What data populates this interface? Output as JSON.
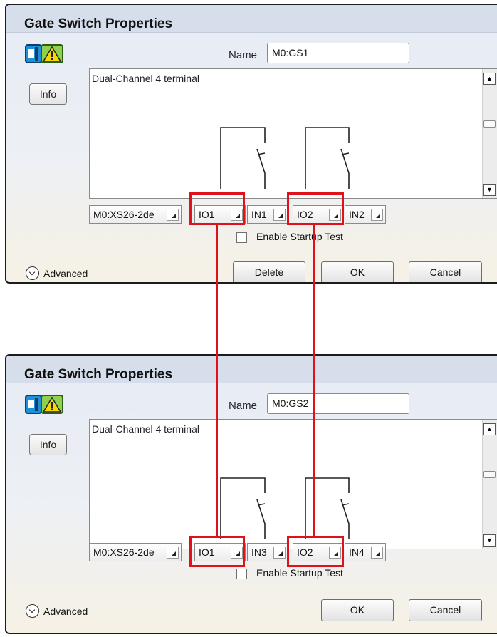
{
  "dialogs": [
    {
      "title": "Gate Switch Properties",
      "name_label": "Name",
      "name_value": "M0:GS1",
      "info_label": "Info",
      "description": "Dual-Channel 4 terminal",
      "module_combo": "M0:XS26-2de",
      "io_a": "IO1",
      "input_a": "IN1",
      "io_b": "IO2",
      "input_b": "IN2",
      "startup_test_label": "Enable Startup Test",
      "startup_test_checked": false,
      "advanced_label": "Advanced",
      "delete_label": "Delete",
      "ok_label": "OK",
      "cancel_label": "Cancel"
    },
    {
      "title": "Gate Switch Properties",
      "name_label": "Name",
      "name_value": "M0:GS2",
      "info_label": "Info",
      "description": "Dual-Channel 4 terminal",
      "module_combo": "M0:XS26-2de",
      "io_a": "IO1",
      "input_a": "IN3",
      "io_b": "IO2",
      "input_b": "IN4",
      "startup_test_label": "Enable Startup Test",
      "startup_test_checked": false,
      "advanced_label": "Advanced",
      "ok_label": "OK",
      "cancel_label": "Cancel"
    }
  ],
  "icons": {
    "gate_switch": "gate-switch-warning-icon",
    "advanced": "chevron-down-circle-icon"
  },
  "colors": {
    "highlight": "#e0111b",
    "title_bar": "#d6deeb"
  }
}
